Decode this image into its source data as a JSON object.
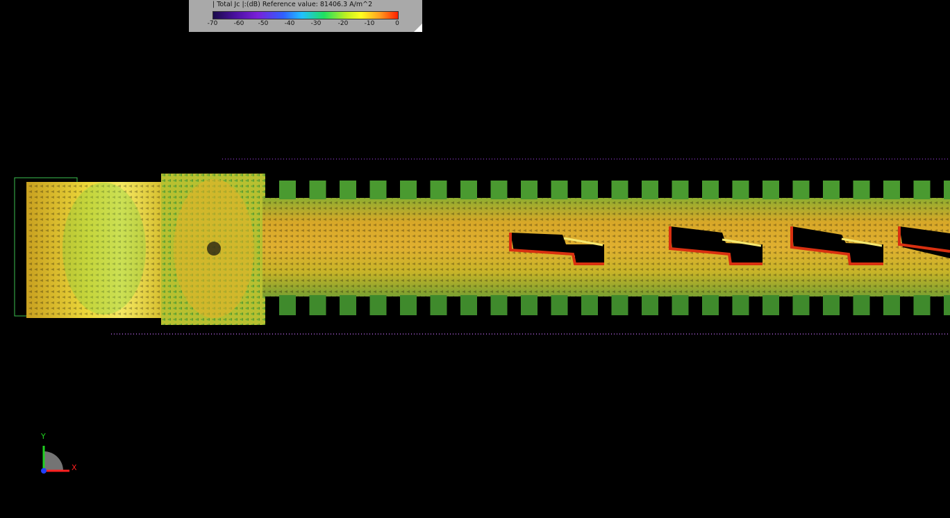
{
  "legend": {
    "title": "| Total Jc |:(dB) Reference value: 81406.3 A/m^2",
    "ticks": [
      "-70",
      "-60",
      "-50",
      "-40",
      "-30",
      "-20",
      "-10",
      "0"
    ]
  },
  "axes": {
    "y_label": "Y",
    "x_label": "X"
  },
  "colors": {
    "background": "#000000",
    "legend_bg": "#a9a9a9",
    "field_green": "#3aa845",
    "field_yellow": "#e8d32a",
    "field_orange": "#e07a14",
    "field_red": "#d02010",
    "axis_x": "#ff2020",
    "axis_y": "#20d020",
    "axis_z": "#2040ff"
  }
}
